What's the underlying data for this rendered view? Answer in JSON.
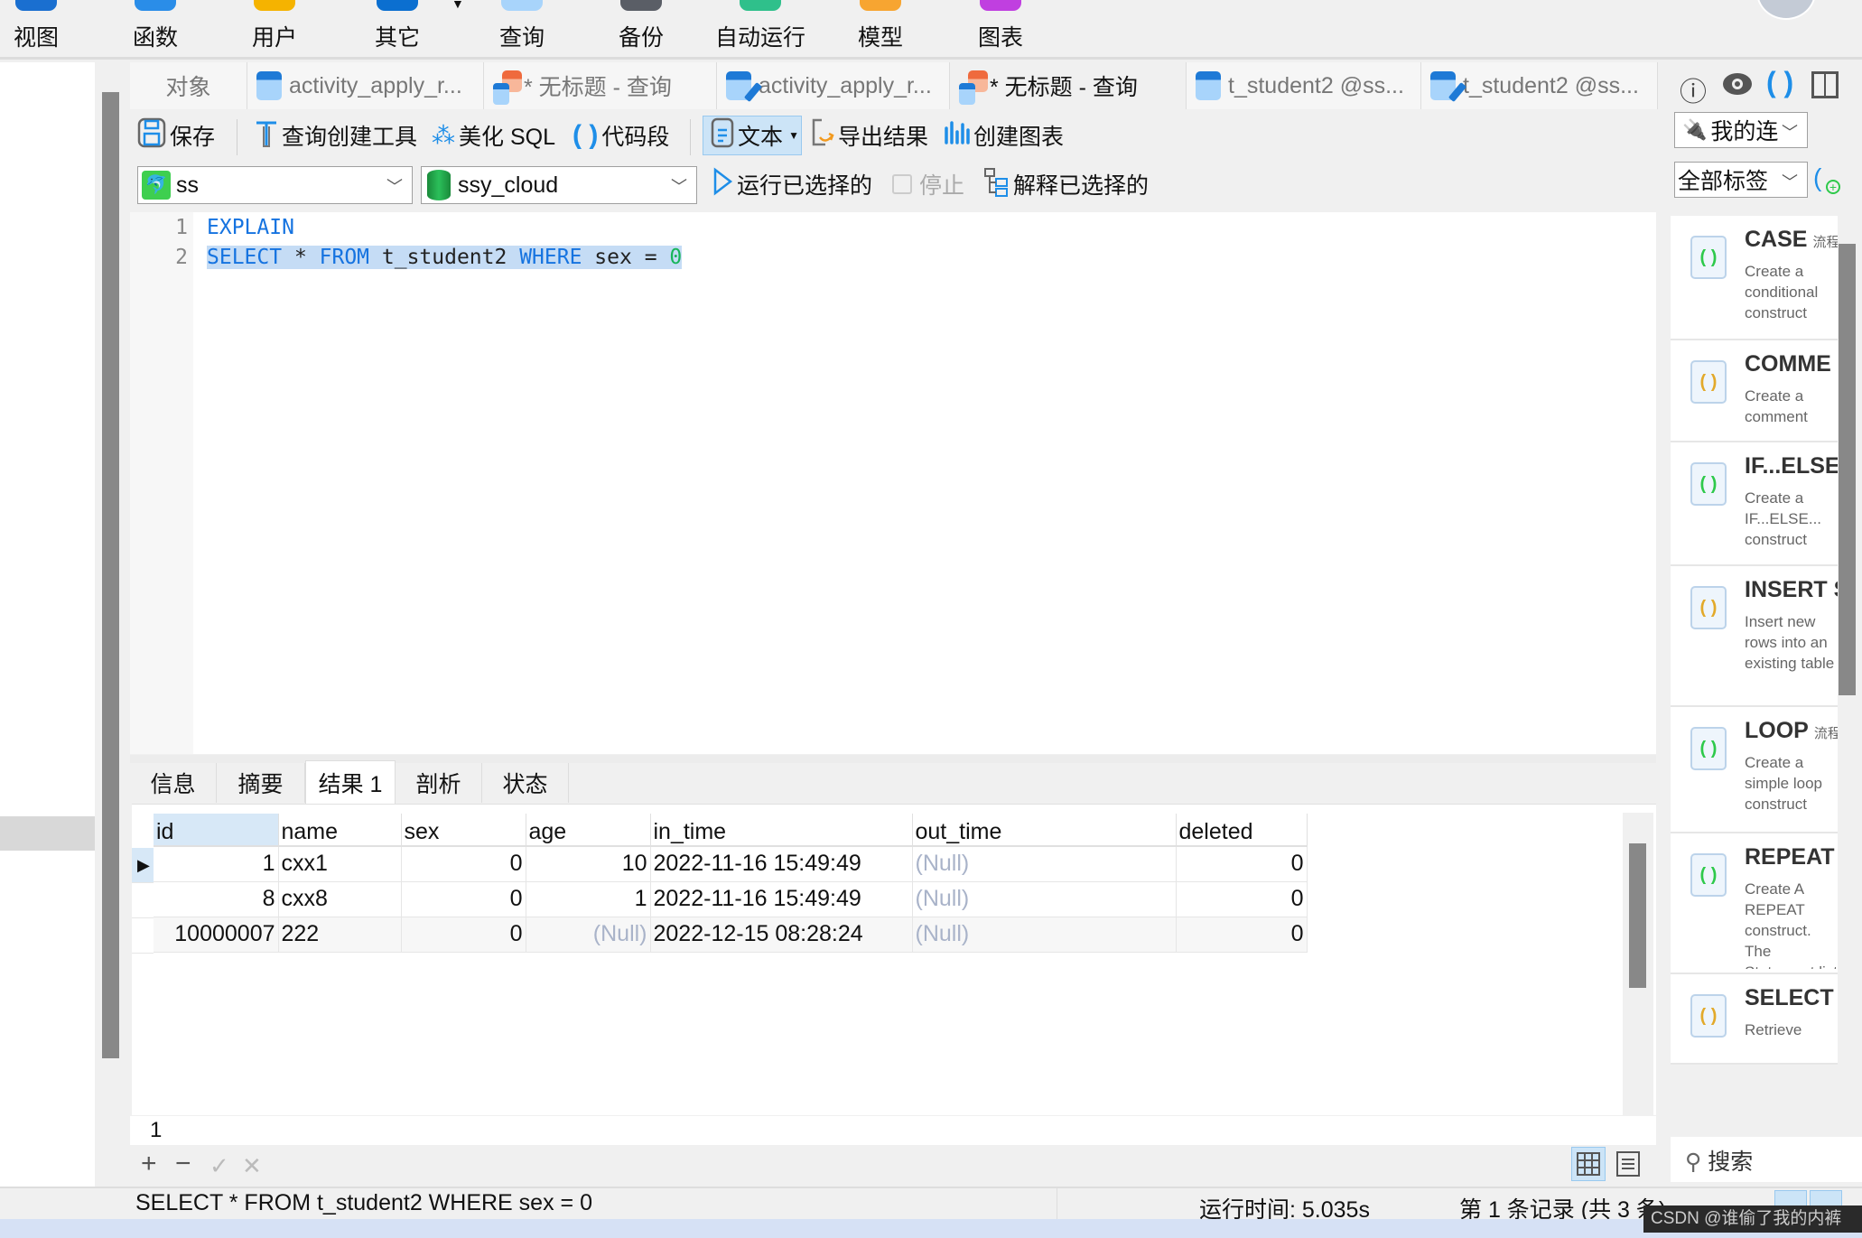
{
  "ribbon": {
    "items": [
      {
        "label": "视图",
        "icon": "view-icon",
        "color": "#1a6fd0"
      },
      {
        "label": "函数",
        "icon": "function-icon",
        "color": "#2a8de8"
      },
      {
        "label": "用户",
        "icon": "user-icon",
        "color": "#f5b300"
      },
      {
        "label": "其它",
        "icon": "others-icon",
        "color": "#0b6fd0"
      },
      {
        "label": "查询",
        "icon": "query-icon",
        "color": "#a8d4fb"
      },
      {
        "label": "备份",
        "icon": "backup-icon",
        "color": "#5a5e66"
      },
      {
        "label": "自动运行",
        "icon": "automation-icon",
        "color": "#2fc08b"
      },
      {
        "label": "模型",
        "icon": "model-icon",
        "color": "#f7a531"
      },
      {
        "label": "图表",
        "icon": "chart-icon",
        "color": "#c03fe0"
      }
    ]
  },
  "tabs": [
    {
      "label": "对象",
      "icon": ""
    },
    {
      "label": "activity_apply_r...",
      "icon": "table-icon"
    },
    {
      "label": "* 无标题 - 查询",
      "icon": "query-icon"
    },
    {
      "label": "activity_apply_r...",
      "icon": "table-edit-icon"
    },
    {
      "label": "* 无标题 - 查询",
      "icon": "query-icon"
    },
    {
      "label": "t_student2 @ss...",
      "icon": "table-icon"
    },
    {
      "label": "t_student2 @ss...",
      "icon": "table-edit-icon"
    }
  ],
  "toolbar": {
    "save": "保存",
    "query_builder": "查询创建工具",
    "beautify": "美化 SQL",
    "snippet": "代码段",
    "text": "文本",
    "export": "导出结果",
    "create_chart": "创建图表",
    "connection": "ss",
    "database": "ssy_cloud",
    "run_selected": "运行已选择的",
    "stop": "停止",
    "explain_selected": "解释已选择的"
  },
  "editor": {
    "lines": [
      {
        "no": "1",
        "tokens": [
          {
            "t": "EXPLAIN",
            "c": "kw"
          }
        ]
      },
      {
        "no": "2",
        "tokens": [
          {
            "t": "SELECT",
            "c": "kw"
          },
          {
            "t": " * ",
            "c": "txt"
          },
          {
            "t": "FROM",
            "c": "kw"
          },
          {
            "t": " t_student2 ",
            "c": "txt"
          },
          {
            "t": "WHERE",
            "c": "kw"
          },
          {
            "t": " sex = ",
            "c": "txt"
          },
          {
            "t": "0",
            "c": "num"
          }
        ]
      }
    ]
  },
  "result_tabs": [
    "信息",
    "摘要",
    "结果 1",
    "剖析",
    "状态"
  ],
  "result_active": 2,
  "grid": {
    "columns": [
      "id",
      "name",
      "sex",
      "age",
      "in_time",
      "out_time",
      "deleted"
    ],
    "rows": [
      [
        "1",
        "cxx1",
        "0",
        "10",
        "2022-11-16 15:49:49",
        "(Null)",
        "0"
      ],
      [
        "8",
        "cxx8",
        "0",
        "1",
        "2022-11-16 15:49:49",
        "(Null)",
        "0"
      ],
      [
        "10000007",
        "222",
        "0",
        "(Null)",
        "2022-12-15 08:28:24",
        "(Null)",
        "0"
      ]
    ]
  },
  "pager": {
    "page": "1"
  },
  "status": {
    "sql": "SELECT * FROM t_student2 WHERE sex = 0",
    "runtime": "运行时间: 5.035s",
    "records": "第 1 条记录 (共 3 条)"
  },
  "right_panel": {
    "connection_filter": "我的连",
    "tag_filter": "全部标签",
    "search": "搜索",
    "snippets": [
      {
        "title": "CASE",
        "tag": "流程",
        "desc": "Create a conditional construct",
        "color": "#2ec94a"
      },
      {
        "title": "COMME",
        "tag": "",
        "desc": "Create a comment",
        "color": "#e2a92a"
      },
      {
        "title": "IF...ELSE",
        "tag": "",
        "desc": "Create a IF...ELSE... construct",
        "color": "#2ec94a"
      },
      {
        "title": "INSERT S",
        "tag": "",
        "desc": "Insert new rows into an existing table",
        "color": "#e2a92a"
      },
      {
        "title": "LOOP",
        "tag": "流程",
        "desc": "Create a simple loop construct",
        "color": "#2ec94a"
      },
      {
        "title": "REPEAT",
        "tag": "",
        "desc": "Create A REPEAT construct. The Statement list is repeated until the",
        "color": "#2ec94a"
      },
      {
        "title": "SELECT S",
        "tag": "",
        "desc": "Retrieve",
        "color": "#e2a92a"
      }
    ]
  },
  "watermark": "CSDN @谁偷了我的内裤"
}
